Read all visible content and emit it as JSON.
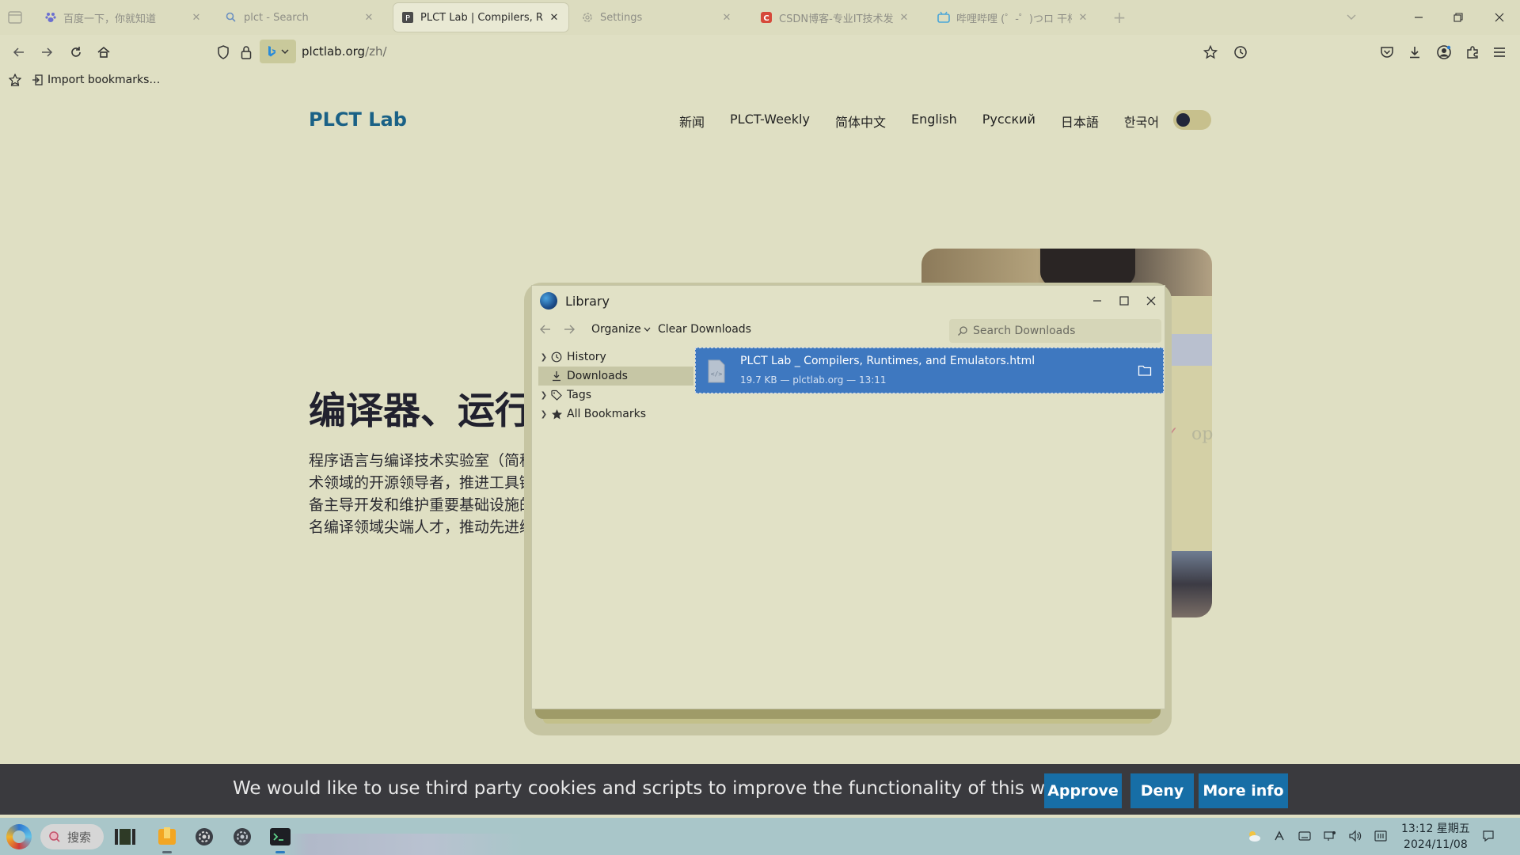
{
  "browser": {
    "tabs": [
      {
        "label": "百度一下，你就知道",
        "icon": "baidu-paw-icon"
      },
      {
        "label": "plct - Search",
        "icon": "search-icon"
      },
      {
        "label": "PLCT Lab | Compilers, Runtimes, and Emulators",
        "icon": "plct-favicon"
      },
      {
        "label": "Settings",
        "icon": "gear-icon"
      },
      {
        "label": "CSDN博客-专业IT技术发表平台",
        "icon": "csdn-icon"
      },
      {
        "label": "哔哩哔哩 (゜-゜)つロ 干杯~",
        "icon": "bilibili-icon"
      }
    ],
    "url_host": "plctlab.org",
    "url_path": "/zh/",
    "bookmarks_toolbar": {
      "import_label": "Import bookmarks…"
    }
  },
  "site": {
    "title": "PLCT Lab",
    "nav": [
      "新闻",
      "PLCT-Weekly",
      "简体中文",
      "English",
      "Русский",
      "日本語",
      "한국어"
    ],
    "hero_title": "编译器、运行时",
    "hero_text": [
      "程序语言与编译技术实验室（简称",
      "术领域的开源领导者，推进工具链",
      "备主导开发和维护重要基础设施的",
      "名编译领域尖端人才，推动先进编"
    ],
    "side_text": "op"
  },
  "library": {
    "title": "Library",
    "organize_label": "Organize",
    "clear_label": "Clear Downloads",
    "search_placeholder": "Search Downloads",
    "tree": [
      {
        "label": "History",
        "icon": "clock-icon",
        "expandable": true,
        "selected": false
      },
      {
        "label": "Downloads",
        "icon": "download-icon",
        "expandable": false,
        "selected": true
      },
      {
        "label": "Tags",
        "icon": "tag-icon",
        "expandable": true,
        "selected": false
      },
      {
        "label": "All Bookmarks",
        "icon": "star-icon",
        "expandable": true,
        "selected": false
      }
    ],
    "downloads": [
      {
        "name": "PLCT Lab _ Compilers, Runtimes, and Emulators.html",
        "meta": "19.7 KB — plctlab.org — 13:11"
      }
    ]
  },
  "cookie": {
    "text": "We would like to use third party cookies and scripts to improve the functionality of this website.",
    "approve": "Approve",
    "deny": "Deny",
    "more_info": "More info"
  },
  "taskbar": {
    "search_label": "搜索",
    "time": "13:12 星期五",
    "date": "2024/11/08"
  },
  "colors": {
    "page_bg": "#dfdfc3",
    "brand": "#1a6186",
    "selection": "#3e78c0",
    "cookie_button": "#176ea6",
    "taskbar": "#a9c6c9"
  }
}
